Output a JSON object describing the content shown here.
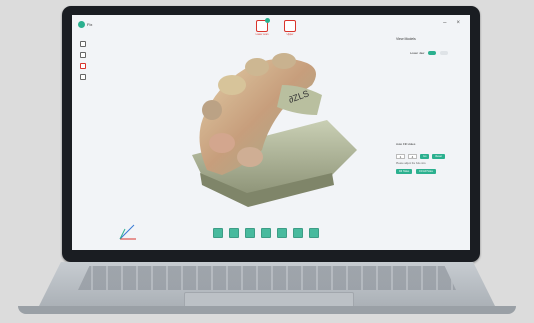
{
  "app": {
    "logo_text": "Fix",
    "window_controls": {
      "minimize": "–",
      "close": "×"
    }
  },
  "top_actions": [
    {
      "icon": "scan-icon",
      "label": "Lower scan"
    },
    {
      "icon": "upper-jaw-icon",
      "label": "Upper"
    }
  ],
  "left_tools": [
    "file-icon",
    "undo-icon",
    "measure-icon",
    "settings-icon"
  ],
  "right_panel": {
    "title": "View Models",
    "row_label": "Lower Jaw",
    "toggle_on": "On",
    "toggle_off": "Off"
  },
  "auto_panel": {
    "title": "Auto Fill Holes",
    "value_a": "1",
    "value_b": "4",
    "btn_apply": "Go",
    "btn_reset": "Reset",
    "hint": "Please adjust the hole size",
    "btn_fill": "Fill Holes",
    "btn_fill_all": "Fill All Holes"
  },
  "bottom_toolbar": [
    "view-front-icon",
    "view-left-icon",
    "view-right-icon",
    "zoom-icon",
    "rotate-icon",
    "grid-icon",
    "texture-icon"
  ],
  "colors": {
    "accent": "#2bb08f",
    "highlight": "#d9342c"
  }
}
